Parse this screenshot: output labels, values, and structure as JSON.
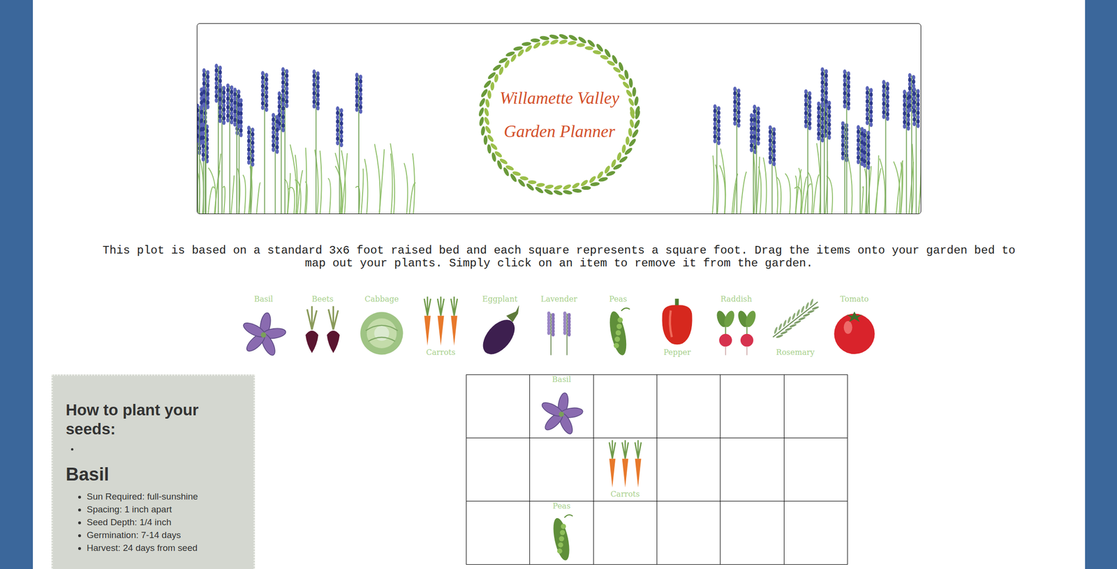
{
  "header": {
    "title_line1": "Willamette Valley",
    "title_line2": "Garden Planner"
  },
  "instructions": "This plot is based on a standard 3x6 foot raised bed and each square represents a square foot. Drag the items onto your garden bed to map out your plants. Simply click on an item to remove it from the garden.",
  "palette": [
    {
      "label": "Basil",
      "kind": "basil"
    },
    {
      "label": "Beets",
      "kind": "beets"
    },
    {
      "label": "Cabbage",
      "kind": "cabbage"
    },
    {
      "label": "Carrots",
      "kind": "carrots"
    },
    {
      "label": "Eggplant",
      "kind": "eggplant"
    },
    {
      "label": "Lavender",
      "kind": "lavender"
    },
    {
      "label": "Peas",
      "kind": "peas"
    },
    {
      "label": "Pepper",
      "kind": "pepper"
    },
    {
      "label": "Raddish",
      "kind": "raddish"
    },
    {
      "label": "Rosemary",
      "kind": "rosemary"
    },
    {
      "label": "Tomato",
      "kind": "tomato"
    }
  ],
  "guide": {
    "heading": "How to plant your seeds:",
    "plant": "Basil",
    "facts": [
      "Sun Required: full-sunshine",
      "Spacing: 1 inch apart",
      "Seed Depth: 1/4 inch",
      "Germination: 7-14 days",
      "Harvest: 24 days from seed"
    ]
  },
  "garden": {
    "rows": [
      [
        {
          "kind": "empty"
        },
        {
          "kind": "basil",
          "label": "Basil"
        },
        {
          "kind": "empty"
        },
        {
          "kind": "empty"
        },
        {
          "kind": "empty"
        },
        {
          "kind": "empty"
        }
      ],
      [
        {
          "kind": "empty"
        },
        {
          "kind": "empty"
        },
        {
          "kind": "carrots",
          "label": "Carrots"
        },
        {
          "kind": "empty"
        },
        {
          "kind": "empty"
        },
        {
          "kind": "empty"
        }
      ],
      [
        {
          "kind": "empty"
        },
        {
          "kind": "peas",
          "label": "Peas"
        },
        {
          "kind": "empty"
        },
        {
          "kind": "empty"
        },
        {
          "kind": "empty"
        },
        {
          "kind": "empty"
        }
      ]
    ]
  }
}
